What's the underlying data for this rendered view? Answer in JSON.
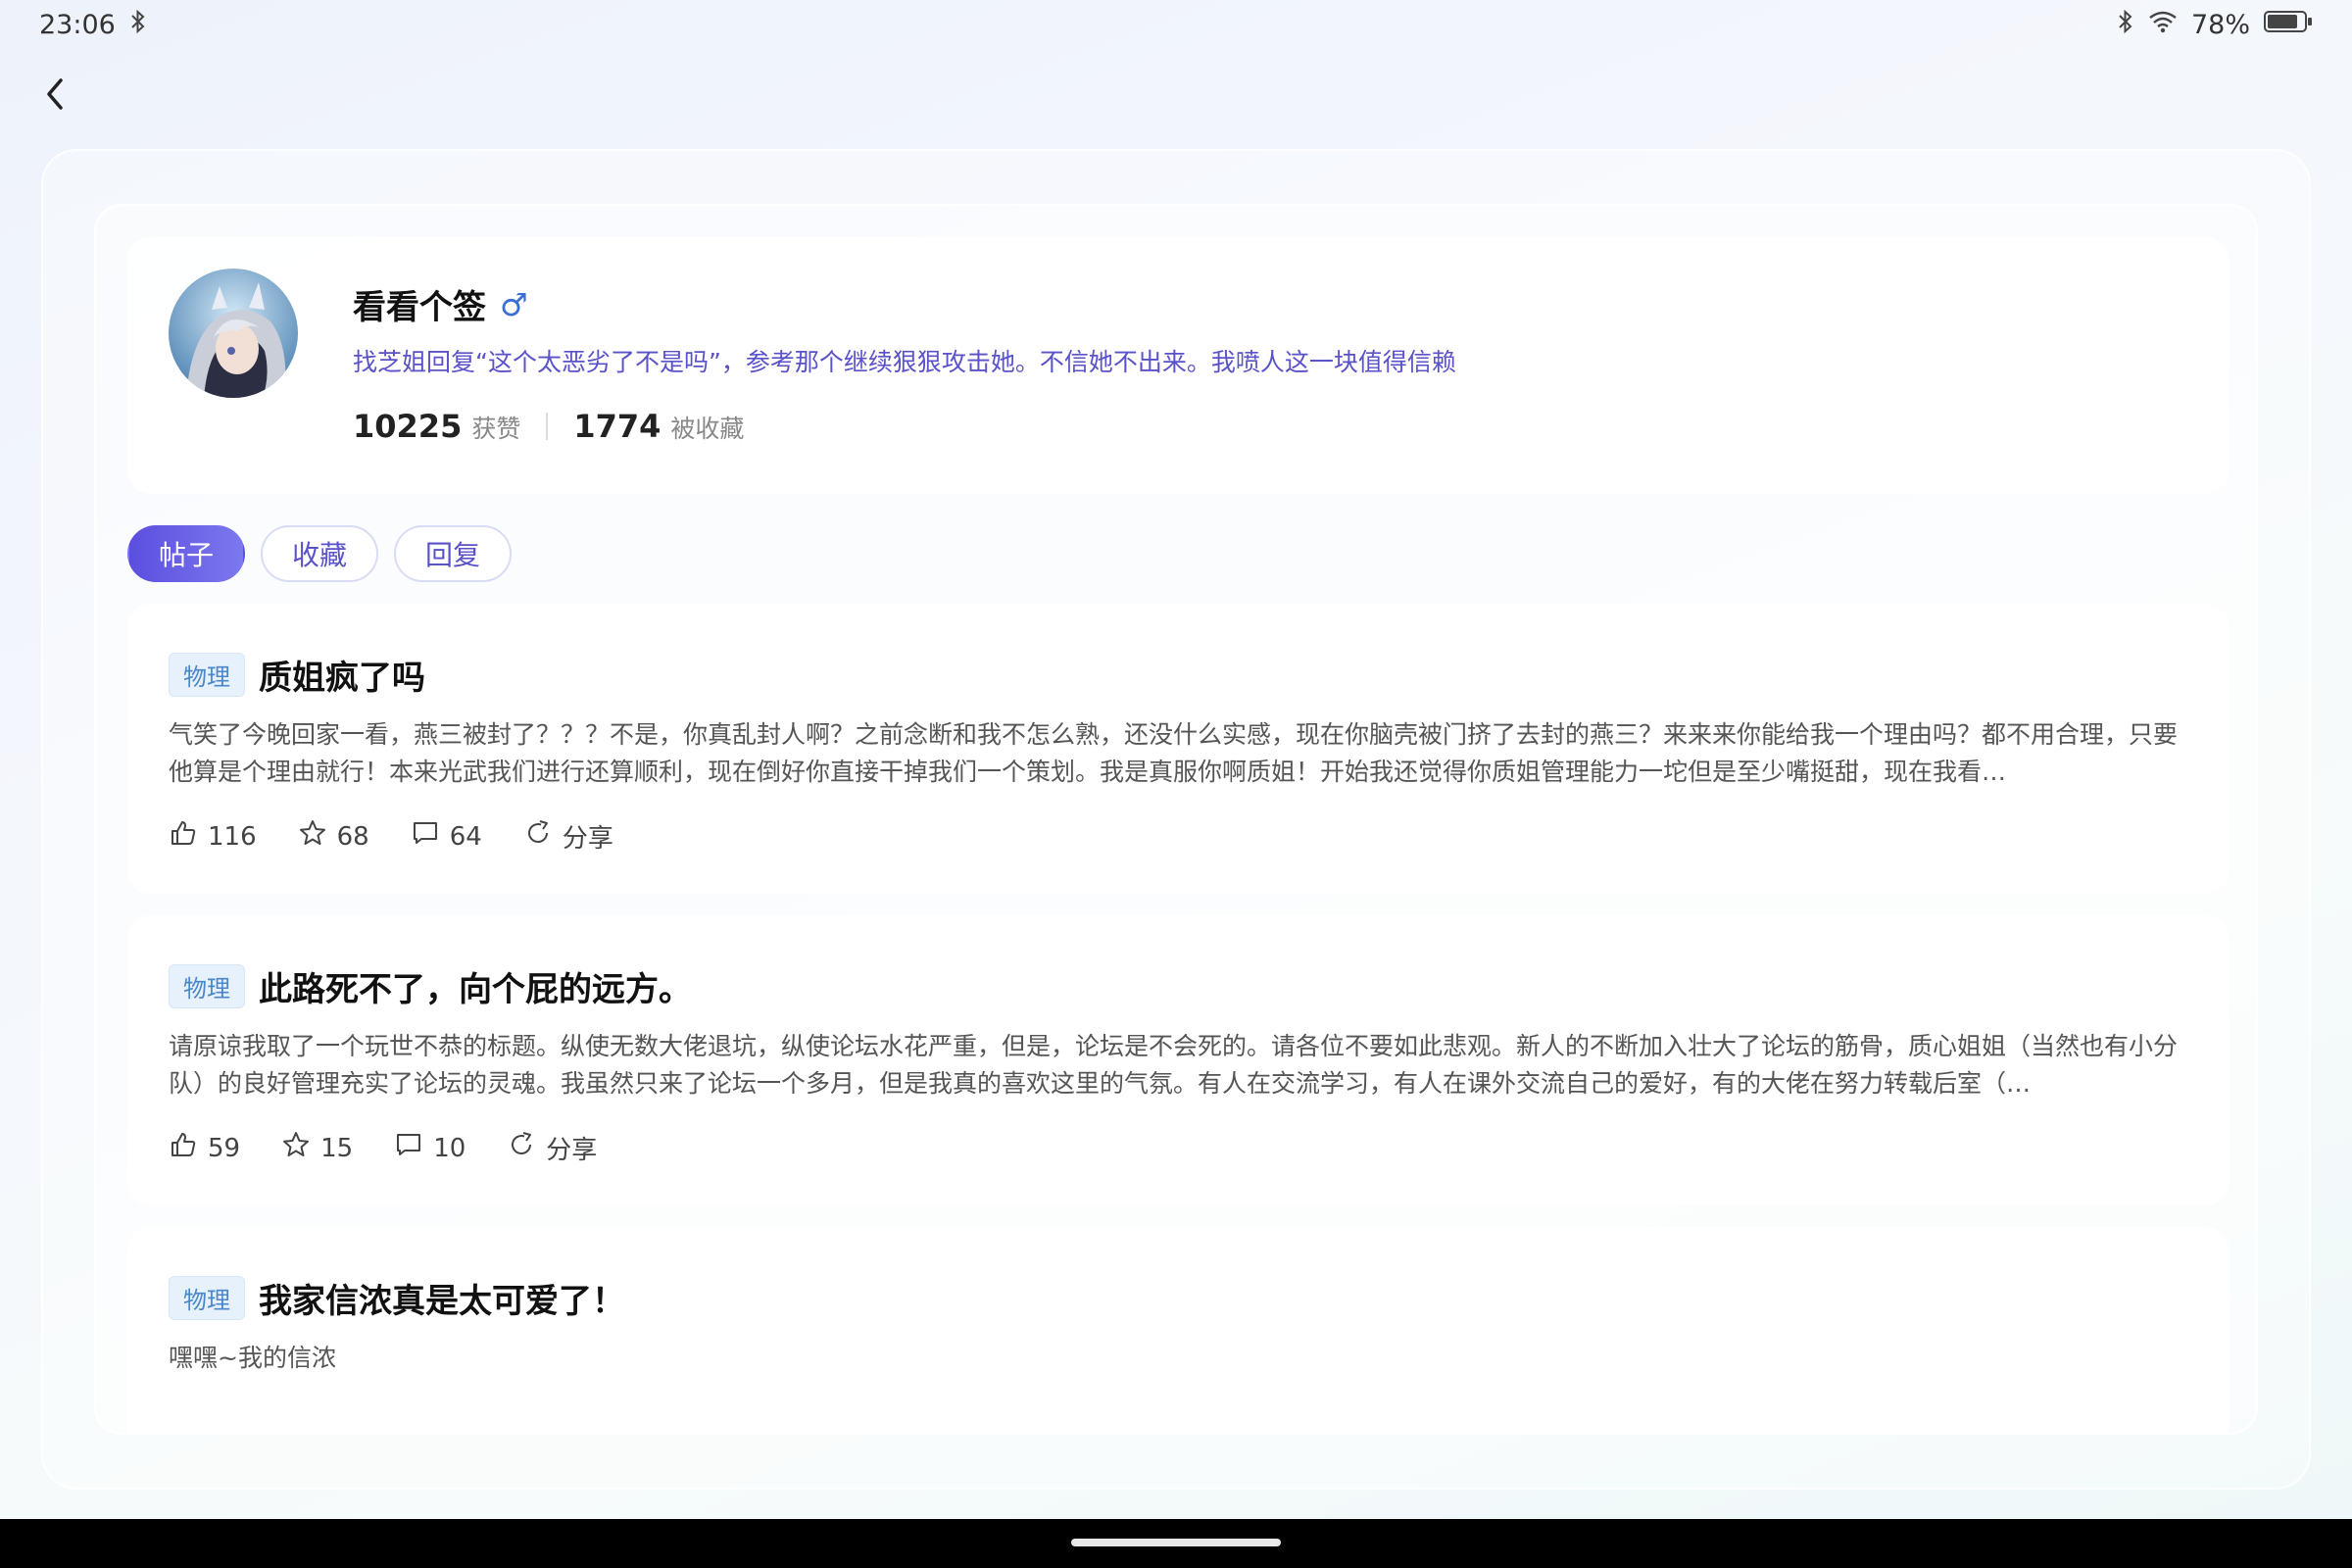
{
  "status_bar": {
    "time": "23:06",
    "battery": "78%"
  },
  "profile": {
    "name": "看看个签",
    "gender_symbol": "♂",
    "signature": "找芝姐回复“这个太恶劣了不是吗”，参考那个继续狠狠攻击她。不信她不出来。我喷人这一块值得信赖",
    "likes_count": "10225",
    "likes_label": "获赞",
    "favorited_count": "1774",
    "favorited_label": "被收藏"
  },
  "tabs": [
    {
      "label": "帖子",
      "active": true
    },
    {
      "label": "收藏",
      "active": false
    },
    {
      "label": "回复",
      "active": false
    }
  ],
  "posts": [
    {
      "tag": "物理",
      "title": "质姐疯了吗",
      "body": "气笑了今晚回家一看，燕三被封了？？？不是，你真乱封人啊？之前念断和我不怎么熟，还没什么实感，现在你脑壳被门挤了去封的燕三？来来来你能给我一个理由吗？都不用合理，只要他算是个理由就行！本来光武我们进行还算顺利，现在倒好你直接干掉我们一个策划。我是真服你啊质姐！开始我还觉得你质姐管理能力一坨但是至少嘴挺甜，现在我看…",
      "likes": "116",
      "stars": "68",
      "comments": "64",
      "share_label": "分享"
    },
    {
      "tag": "物理",
      "title": "此路死不了，向个屁的远方。",
      "body": "请原谅我取了一个玩世不恭的标题。纵使无数大佬退坑，纵使论坛水花严重，但是，论坛是不会死的。请各位不要如此悲观。新人的不断加入壮大了论坛的筋骨，质心姐姐（当然也有小分队）的良好管理充实了论坛的灵魂。我虽然只来了论坛一个多月，但是我真的喜欢这里的气氛。有人在交流学习，有人在课外交流自己的爱好，有的大佬在努力转载后室（…",
      "likes": "59",
      "stars": "15",
      "comments": "10",
      "share_label": "分享"
    },
    {
      "tag": "物理",
      "title": "我家信浓真是太可爱了！",
      "body": "嘿嘿~我的信浓"
    }
  ]
}
